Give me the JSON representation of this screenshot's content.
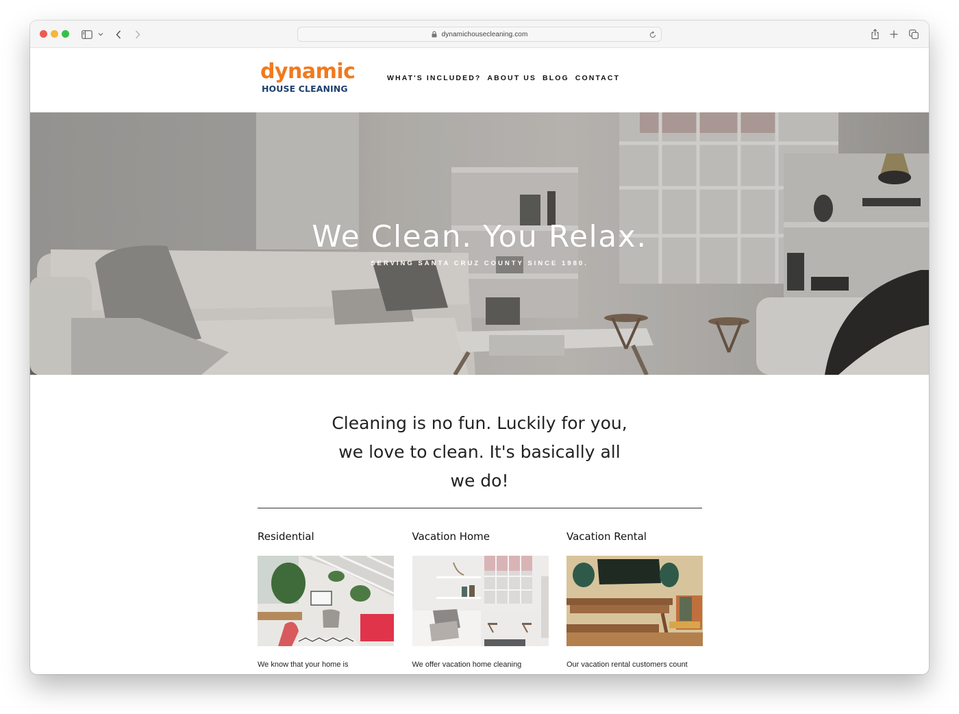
{
  "browser": {
    "url": "dynamichousecleaning.com",
    "icons": {
      "sidebar": "sidebar-icon",
      "back": "chevron-left-icon",
      "forward": "chevron-right-icon",
      "lock": "lock-icon",
      "reload": "reload-icon",
      "share": "share-icon",
      "new_tab": "plus-icon",
      "tabs": "tabs-overview-icon"
    }
  },
  "site": {
    "logo": {
      "top": "dynamic",
      "bottom": "HOUSE CLEANING",
      "colors": {
        "top": "#f07a1e",
        "bottom": "#1c3f6e"
      }
    },
    "nav": [
      {
        "label": "WHAT'S INCLUDED?"
      },
      {
        "label": "ABOUT US"
      },
      {
        "label": "BLOG"
      },
      {
        "label": "CONTACT"
      }
    ]
  },
  "hero": {
    "title": "We Clean. You Relax.",
    "subtitle": "SERVING SANTA CRUZ COUNTY SINCE 1980.",
    "image": "living-room-photo"
  },
  "intro": {
    "lines": [
      "Cleaning is no fun. Luckily for you,",
      "we love to clean. It's basically all",
      "we do!"
    ]
  },
  "services": [
    {
      "title": "Residential",
      "image": "home-office-photo",
      "description": "We know that your home is"
    },
    {
      "title": "Vacation Home",
      "image": "white-living-room-photo",
      "description": "We offer vacation home cleaning"
    },
    {
      "title": "Vacation Rental",
      "image": "dining-room-photo",
      "description": "Our vacation rental customers count"
    }
  ]
}
